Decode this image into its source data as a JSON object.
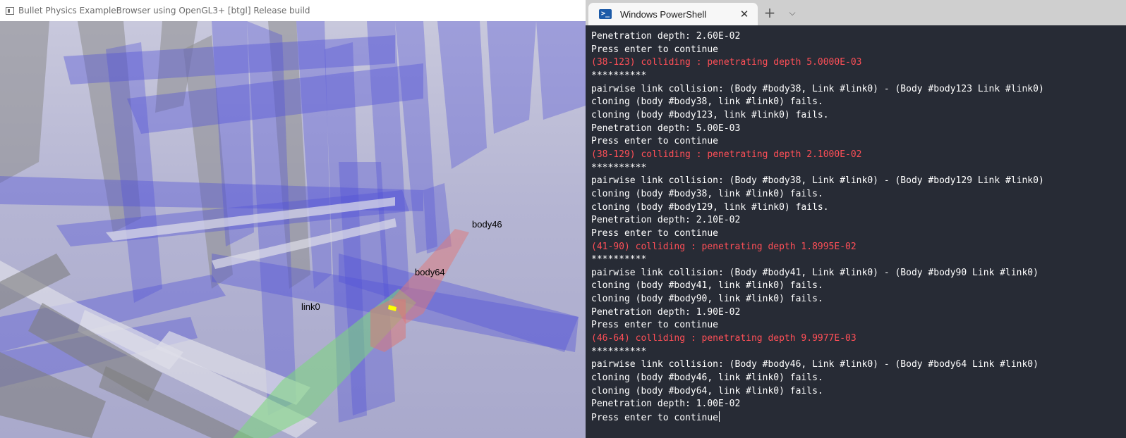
{
  "bullet_window": {
    "title": "Bullet Physics ExampleBrowser using OpenGL3+ [btgl] Release build",
    "labels": {
      "body46": "body46",
      "body64": "body64",
      "link0": "link0"
    },
    "colors": {
      "background": "#b8b8d6",
      "blue_box": "#5a5ad8",
      "gray_box": "#8c8c8c",
      "red_box": "#d87878",
      "green_box": "#7ad87a",
      "contact_marker": "#ffff00"
    }
  },
  "powershell": {
    "tab_title": "Windows PowerShell",
    "tab_icon": "powershell-icon",
    "new_tab_icon": "plus-icon",
    "dropdown_icon": "chevron-down-icon",
    "close_icon": "close-icon",
    "colors": {
      "background": "#272b35",
      "text": "#ffffff",
      "error_text": "#ff4f57"
    },
    "lines": [
      {
        "text": "Penetration depth: 2.60E-02",
        "style": "normal"
      },
      {
        "text": "Press enter to continue",
        "style": "normal"
      },
      {
        "text": "(38-123) colliding : penetrating depth 5.0000E-03",
        "style": "red"
      },
      {
        "text": "**********",
        "style": "normal"
      },
      {
        "text": "pairwise link collision: (Body #body38, Link #link0) - (Body #body123 Link #link0)",
        "style": "normal"
      },
      {
        "text": "cloning (body #body38, link #link0) fails.",
        "style": "normal"
      },
      {
        "text": "cloning (body #body123, link #link0) fails.",
        "style": "normal"
      },
      {
        "text": "Penetration depth: 5.00E-03",
        "style": "normal"
      },
      {
        "text": "Press enter to continue",
        "style": "normal"
      },
      {
        "text": "(38-129) colliding : penetrating depth 2.1000E-02",
        "style": "red"
      },
      {
        "text": "**********",
        "style": "normal"
      },
      {
        "text": "pairwise link collision: (Body #body38, Link #link0) - (Body #body129 Link #link0)",
        "style": "normal"
      },
      {
        "text": "cloning (body #body38, link #link0) fails.",
        "style": "normal"
      },
      {
        "text": "cloning (body #body129, link #link0) fails.",
        "style": "normal"
      },
      {
        "text": "Penetration depth: 2.10E-02",
        "style": "normal"
      },
      {
        "text": "Press enter to continue",
        "style": "normal"
      },
      {
        "text": "(41-90) colliding : penetrating depth 1.8995E-02",
        "style": "red"
      },
      {
        "text": "**********",
        "style": "normal"
      },
      {
        "text": "pairwise link collision: (Body #body41, Link #link0) - (Body #body90 Link #link0)",
        "style": "normal"
      },
      {
        "text": "cloning (body #body41, link #link0) fails.",
        "style": "normal"
      },
      {
        "text": "cloning (body #body90, link #link0) fails.",
        "style": "normal"
      },
      {
        "text": "Penetration depth: 1.90E-02",
        "style": "normal"
      },
      {
        "text": "Press enter to continue",
        "style": "normal"
      },
      {
        "text": "(46-64) colliding : penetrating depth 9.9977E-03",
        "style": "red"
      },
      {
        "text": "**********",
        "style": "normal"
      },
      {
        "text": "pairwise link collision: (Body #body46, Link #link0) - (Body #body64 Link #link0)",
        "style": "normal"
      },
      {
        "text": "cloning (body #body46, link #link0) fails.",
        "style": "normal"
      },
      {
        "text": "cloning (body #body64, link #link0) fails.",
        "style": "normal"
      },
      {
        "text": "Penetration depth: 1.00E-02",
        "style": "normal"
      },
      {
        "text": "Press enter to continue",
        "style": "prompt"
      }
    ]
  }
}
